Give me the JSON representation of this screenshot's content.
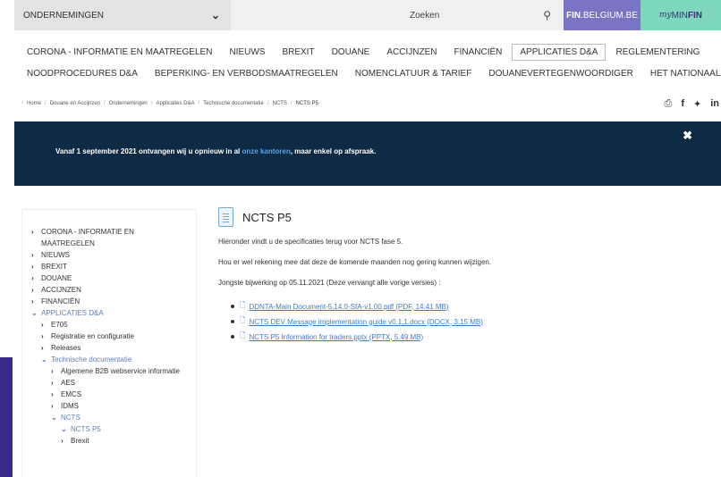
{
  "topbar": {
    "select_label": "ONDERNEMINGEN",
    "search_placeholder": "Zoeken",
    "fin_brand": "FIN",
    "fin_suffix": ".BELGIUM.BE",
    "myfin_prefix": "my",
    "myfin_mid": "MIN",
    "myfin_end": "FIN"
  },
  "nav": {
    "row1": [
      "CORONA - INFORMATIE EN MAATREGELEN",
      "NIEUWS",
      "BREXIT",
      "DOUANE",
      "ACCIJNZEN",
      "FINANCIËN",
      "APPLICATIES D&A",
      "REGLEMENTERING"
    ],
    "row2": [
      "NOODPROCEDURES D&A",
      "BEPERKING- EN VERBODSMAATREGELEN",
      "NOMENCLATUUR & TARIEF",
      "DOUANEVERTEGENWOORDIGER",
      "HET NATIONAAL FORUM"
    ],
    "active": "APPLICATIES D&A"
  },
  "breadcrumb": [
    "Home",
    "Douane en Accijnzen",
    "Ondernemingen",
    "Applicaties D&A",
    "Technische documentatie",
    "NCTS",
    "NCTS P5"
  ],
  "banner": {
    "text_before": "Vanaf 1 september 2021 ontvangen wij u opnieuw in al ",
    "link": "onze kantoren",
    "text_after": ", maar enkel op afspraak."
  },
  "sidebar": {
    "items": [
      {
        "label": "CORONA - INFORMATIE EN MAATREGELEN",
        "level": 0,
        "open": false
      },
      {
        "label": "NIEUWS",
        "level": 0,
        "open": false
      },
      {
        "label": "BREXIT",
        "level": 0,
        "open": false
      },
      {
        "label": "DOUANE",
        "level": 0,
        "open": false
      },
      {
        "label": "ACCIJNZEN",
        "level": 0,
        "open": false
      },
      {
        "label": "FINANCIËN",
        "level": 0,
        "open": false
      },
      {
        "label": "APPLICATIES D&A",
        "level": 0,
        "open": true
      },
      {
        "label": "E705",
        "level": 1,
        "open": false
      },
      {
        "label": "Registratie en configuratie",
        "level": 1,
        "open": false
      },
      {
        "label": "Releases",
        "level": 1,
        "open": false
      },
      {
        "label": "Technische documentatie",
        "level": 1,
        "open": true
      },
      {
        "label": "Algemene B2B webservice informatie",
        "level": 2,
        "open": false
      },
      {
        "label": "AES",
        "level": 2,
        "open": false
      },
      {
        "label": "EMCS",
        "level": 2,
        "open": false
      },
      {
        "label": "IDMS",
        "level": 2,
        "open": false
      },
      {
        "label": "NCTS",
        "level": 2,
        "open": true
      },
      {
        "label": "NCTS P5",
        "level": 3,
        "open": true
      },
      {
        "label": "Brexit",
        "level": 3,
        "open": false
      }
    ]
  },
  "content": {
    "title": "NCTS P5",
    "p1": "Hieronder vindt u de specificaties terug voor NCTS fase 5.",
    "p2": "Hou er wel rekening mee dat deze de komende maanden nog gering kunnen wijzigen.",
    "p3": "Jongste bijwerking op 05.11.2021 (Deze vervangt alle vorige versies) :",
    "files": [
      "DDNTA-Main Document-5.14.0-SfA-v1.00.pdf (PDF, 14.41 MB)",
      "NCTS DEV Message implementation guide v0.1.1.docx (DOCX, 3.15 MB)",
      "NCTS P5 Information for traders.pptx (PPTX, 5.49 MB)"
    ]
  }
}
